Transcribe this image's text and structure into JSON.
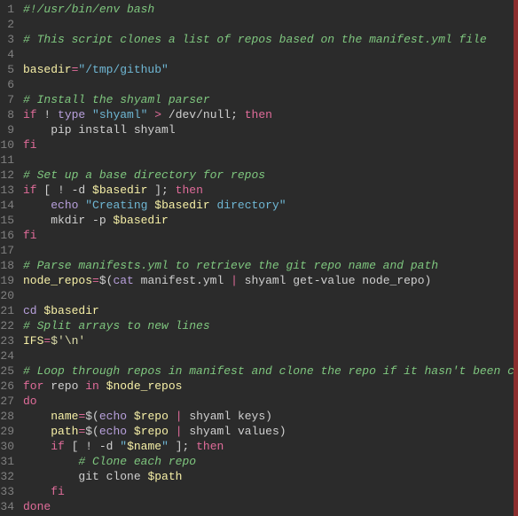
{
  "lines": [
    {
      "n": 1,
      "tokens": [
        {
          "t": "#!/usr/bin/env bash",
          "c": "tk-comment"
        }
      ]
    },
    {
      "n": 2,
      "tokens": []
    },
    {
      "n": 3,
      "tokens": [
        {
          "t": "# This script clones a list of repos based on the manifest.yml file",
          "c": "tk-comment"
        }
      ]
    },
    {
      "n": 4,
      "tokens": []
    },
    {
      "n": 5,
      "tokens": [
        {
          "t": "basedir",
          "c": "tk-var"
        },
        {
          "t": "=",
          "c": "tk-op"
        },
        {
          "t": "\"/tmp/github\"",
          "c": "tk-string"
        }
      ]
    },
    {
      "n": 6,
      "tokens": []
    },
    {
      "n": 7,
      "tokens": [
        {
          "t": "# Install the shyaml parser",
          "c": "tk-comment"
        }
      ]
    },
    {
      "n": 8,
      "tokens": [
        {
          "t": "if",
          "c": "tk-keyword"
        },
        {
          "t": " ! ",
          "c": "tk-punc"
        },
        {
          "t": "type",
          "c": "tk-cmd"
        },
        {
          "t": " ",
          "c": "tk-default"
        },
        {
          "t": "\"shyaml\"",
          "c": "tk-string"
        },
        {
          "t": " ",
          "c": "tk-default"
        },
        {
          "t": ">",
          "c": "tk-op"
        },
        {
          "t": " /dev/null; ",
          "c": "tk-default"
        },
        {
          "t": "then",
          "c": "tk-keyword"
        }
      ]
    },
    {
      "n": 9,
      "tokens": [
        {
          "t": "    pip install shyaml",
          "c": "tk-default"
        }
      ]
    },
    {
      "n": 10,
      "tokens": [
        {
          "t": "fi",
          "c": "tk-keyword"
        }
      ]
    },
    {
      "n": 11,
      "tokens": []
    },
    {
      "n": 12,
      "tokens": [
        {
          "t": "# Set up a base directory for repos",
          "c": "tk-comment"
        }
      ]
    },
    {
      "n": 13,
      "tokens": [
        {
          "t": "if",
          "c": "tk-keyword"
        },
        {
          "t": " [ ! -d ",
          "c": "tk-default"
        },
        {
          "t": "$basedir",
          "c": "tk-var"
        },
        {
          "t": " ]; ",
          "c": "tk-default"
        },
        {
          "t": "then",
          "c": "tk-keyword"
        }
      ]
    },
    {
      "n": 14,
      "tokens": [
        {
          "t": "    ",
          "c": "tk-default"
        },
        {
          "t": "echo",
          "c": "tk-cmd"
        },
        {
          "t": " ",
          "c": "tk-default"
        },
        {
          "t": "\"Creating ",
          "c": "tk-string"
        },
        {
          "t": "$basedir",
          "c": "tk-var"
        },
        {
          "t": " directory\"",
          "c": "tk-string"
        }
      ]
    },
    {
      "n": 15,
      "tokens": [
        {
          "t": "    mkdir -p ",
          "c": "tk-default"
        },
        {
          "t": "$basedir",
          "c": "tk-var"
        }
      ]
    },
    {
      "n": 16,
      "tokens": [
        {
          "t": "fi",
          "c": "tk-keyword"
        }
      ]
    },
    {
      "n": 17,
      "tokens": []
    },
    {
      "n": 18,
      "tokens": [
        {
          "t": "# Parse manifests.yml to retrieve the git repo name and path",
          "c": "tk-comment"
        }
      ]
    },
    {
      "n": 19,
      "tokens": [
        {
          "t": "node_repos",
          "c": "tk-var"
        },
        {
          "t": "=",
          "c": "tk-op"
        },
        {
          "t": "$(",
          "c": "tk-punc"
        },
        {
          "t": "cat",
          "c": "tk-cmd"
        },
        {
          "t": " manifest.yml ",
          "c": "tk-default"
        },
        {
          "t": "|",
          "c": "tk-op"
        },
        {
          "t": " shyaml get-value node_repo",
          "c": "tk-default"
        },
        {
          "t": ")",
          "c": "tk-punc"
        }
      ]
    },
    {
      "n": 20,
      "tokens": []
    },
    {
      "n": 21,
      "tokens": [
        {
          "t": "cd",
          "c": "tk-cmd"
        },
        {
          "t": " ",
          "c": "tk-default"
        },
        {
          "t": "$basedir",
          "c": "tk-var"
        }
      ]
    },
    {
      "n": 22,
      "tokens": [
        {
          "t": "# Split arrays to new lines",
          "c": "tk-comment"
        }
      ]
    },
    {
      "n": 23,
      "tokens": [
        {
          "t": "IFS",
          "c": "tk-var"
        },
        {
          "t": "=",
          "c": "tk-op"
        },
        {
          "t": "$'\\n'",
          "c": "tk-stringalt"
        }
      ]
    },
    {
      "n": 24,
      "tokens": []
    },
    {
      "n": 25,
      "tokens": [
        {
          "t": "# Loop through repos in manifest and clone the repo if it hasn't been cloned yet",
          "c": "tk-comment"
        }
      ]
    },
    {
      "n": 26,
      "tokens": [
        {
          "t": "for",
          "c": "tk-keyword"
        },
        {
          "t": " repo ",
          "c": "tk-default"
        },
        {
          "t": "in",
          "c": "tk-keyword"
        },
        {
          "t": " ",
          "c": "tk-default"
        },
        {
          "t": "$node_repos",
          "c": "tk-var"
        }
      ]
    },
    {
      "n": 27,
      "tokens": [
        {
          "t": "do",
          "c": "tk-keyword"
        }
      ]
    },
    {
      "n": 28,
      "tokens": [
        {
          "t": "    ",
          "c": "tk-default"
        },
        {
          "t": "name",
          "c": "tk-var"
        },
        {
          "t": "=",
          "c": "tk-op"
        },
        {
          "t": "$(",
          "c": "tk-punc"
        },
        {
          "t": "echo",
          "c": "tk-cmd"
        },
        {
          "t": " ",
          "c": "tk-default"
        },
        {
          "t": "$repo",
          "c": "tk-var"
        },
        {
          "t": " ",
          "c": "tk-default"
        },
        {
          "t": "|",
          "c": "tk-op"
        },
        {
          "t": " shyaml keys",
          "c": "tk-default"
        },
        {
          "t": ")",
          "c": "tk-punc"
        }
      ]
    },
    {
      "n": 29,
      "tokens": [
        {
          "t": "    ",
          "c": "tk-default"
        },
        {
          "t": "path",
          "c": "tk-var"
        },
        {
          "t": "=",
          "c": "tk-op"
        },
        {
          "t": "$(",
          "c": "tk-punc"
        },
        {
          "t": "echo",
          "c": "tk-cmd"
        },
        {
          "t": " ",
          "c": "tk-default"
        },
        {
          "t": "$repo",
          "c": "tk-var"
        },
        {
          "t": " ",
          "c": "tk-default"
        },
        {
          "t": "|",
          "c": "tk-op"
        },
        {
          "t": " shyaml values",
          "c": "tk-default"
        },
        {
          "t": ")",
          "c": "tk-punc"
        }
      ]
    },
    {
      "n": 30,
      "tokens": [
        {
          "t": "    ",
          "c": "tk-default"
        },
        {
          "t": "if",
          "c": "tk-keyword"
        },
        {
          "t": " [ ! -d ",
          "c": "tk-default"
        },
        {
          "t": "\"",
          "c": "tk-string"
        },
        {
          "t": "$name",
          "c": "tk-var"
        },
        {
          "t": "\"",
          "c": "tk-string"
        },
        {
          "t": " ]; ",
          "c": "tk-default"
        },
        {
          "t": "then",
          "c": "tk-keyword"
        }
      ]
    },
    {
      "n": 31,
      "tokens": [
        {
          "t": "        ",
          "c": "tk-default"
        },
        {
          "t": "# Clone each repo",
          "c": "tk-comment"
        }
      ]
    },
    {
      "n": 32,
      "tokens": [
        {
          "t": "        git clone ",
          "c": "tk-default"
        },
        {
          "t": "$path",
          "c": "tk-var"
        }
      ]
    },
    {
      "n": 33,
      "tokens": [
        {
          "t": "    ",
          "c": "tk-default"
        },
        {
          "t": "fi",
          "c": "tk-keyword"
        }
      ]
    },
    {
      "n": 34,
      "tokens": [
        {
          "t": "done",
          "c": "tk-keyword"
        }
      ]
    }
  ]
}
